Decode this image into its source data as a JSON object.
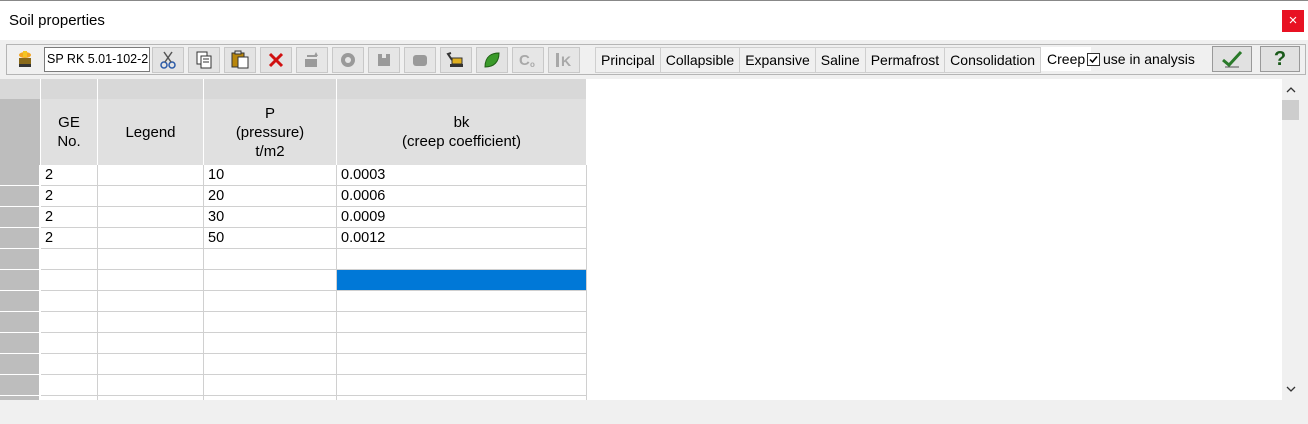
{
  "window": {
    "title": "Soil properties",
    "close_glyph": "×"
  },
  "toolbar": {
    "combo_value": "SP RK 5.01-102-2",
    "icons": [
      "soil-db-icon",
      "cut-icon",
      "copy-icon",
      "paste-icon",
      "delete-icon",
      "add-layer-icon",
      "gear-icon",
      "hammer-icon",
      "layer-icon",
      "excavator-icon",
      "leaf-icon",
      "c-coefficient-icon",
      "k-coefficient-icon"
    ],
    "tabs": [
      "Principal",
      "Collapsible",
      "Expansive",
      "Saline",
      "Permafrost",
      "Consolidation",
      "Creep"
    ],
    "active_tab": "Creep",
    "use_in_analysis_label": "use in analysis",
    "use_in_analysis_checked": true,
    "help_label": "?"
  },
  "table": {
    "headers": {
      "ge_no": [
        "GE",
        "No."
      ],
      "legend": [
        "Legend"
      ],
      "pressure": [
        "P",
        "(pressure)",
        "t/m2"
      ],
      "bk": [
        "bk",
        "(creep coefficient)"
      ]
    },
    "rows": [
      {
        "ge": "2",
        "legend": "",
        "p": "10",
        "bk": "0.0003"
      },
      {
        "ge": "2",
        "legend": "",
        "p": "20",
        "bk": "0.0006"
      },
      {
        "ge": "2",
        "legend": "",
        "p": "30",
        "bk": "0.0009"
      },
      {
        "ge": "2",
        "legend": "",
        "p": "50",
        "bk": "0.0012"
      },
      {
        "ge": "",
        "legend": "",
        "p": "",
        "bk": ""
      },
      {
        "ge": "",
        "legend": "",
        "p": "",
        "bk": "",
        "selected_bk": true
      },
      {
        "ge": "",
        "legend": "",
        "p": "",
        "bk": ""
      },
      {
        "ge": "",
        "legend": "",
        "p": "",
        "bk": ""
      },
      {
        "ge": "",
        "legend": "",
        "p": "",
        "bk": ""
      },
      {
        "ge": "",
        "legend": "",
        "p": "",
        "bk": ""
      },
      {
        "ge": "",
        "legend": "",
        "p": "",
        "bk": ""
      },
      {
        "ge": "",
        "legend": "",
        "p": "",
        "bk": ""
      }
    ]
  },
  "colors": {
    "selection": "#0078d7",
    "close": "#e81123",
    "header": "#e0e0e0"
  }
}
